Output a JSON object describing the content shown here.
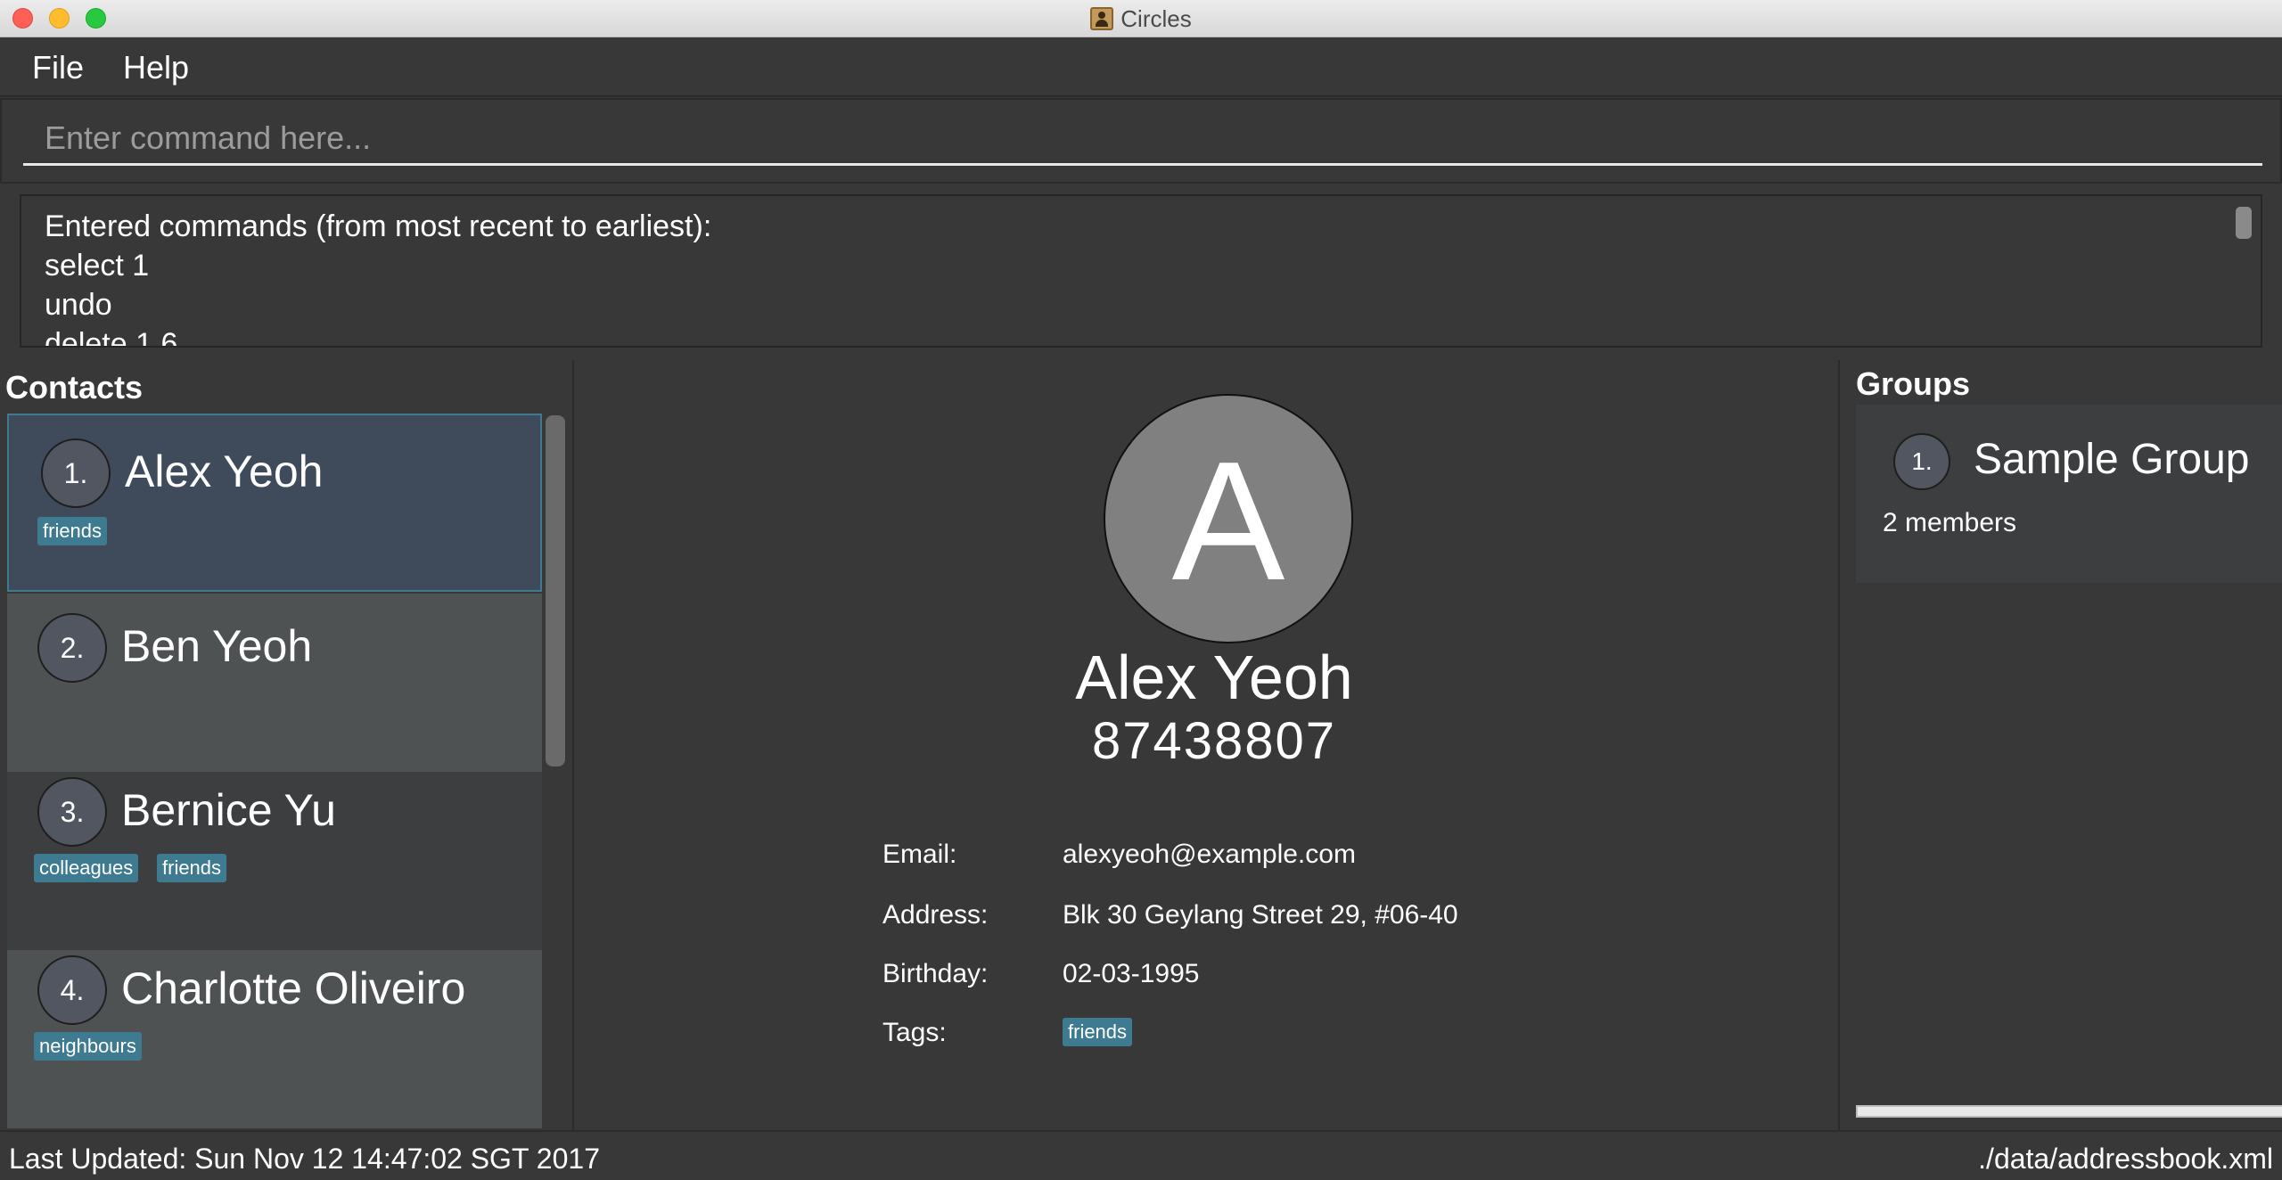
{
  "window": {
    "title": "Circles",
    "app_icon": "address-book-icon"
  },
  "menu": {
    "file": "File",
    "help": "Help"
  },
  "command": {
    "placeholder": "Enter command here...",
    "value": ""
  },
  "result": {
    "text": "Entered commands (from most recent to earliest):\nselect 1\nundo\ndelete 1 6"
  },
  "contacts": {
    "title": "Contacts",
    "items": [
      {
        "index": "1.",
        "name": "Alex Yeoh",
        "tags": [
          "friends"
        ],
        "selected": true
      },
      {
        "index": "2.",
        "name": "Ben Yeoh",
        "tags": []
      },
      {
        "index": "3.",
        "name": "Bernice Yu",
        "tags": [
          "colleagues",
          "friends"
        ]
      },
      {
        "index": "4.",
        "name": "Charlotte Oliveiro",
        "tags": [
          "neighbours"
        ]
      }
    ]
  },
  "detail": {
    "avatar_letter": "A",
    "name": "Alex Yeoh",
    "phone": "87438807",
    "email_label": "Email:",
    "email": "alexyeoh@example.com",
    "address_label": "Address:",
    "address": "Blk 30 Geylang Street 29, #06-40",
    "birthday_label": "Birthday:",
    "birthday": "02-03-1995",
    "tags_label": "Tags:",
    "tags": [
      "friends"
    ]
  },
  "groups": {
    "title": "Groups",
    "items": [
      {
        "index": "1.",
        "name": "Sample Group",
        "members": "2 members"
      }
    ]
  },
  "status": {
    "last_updated": "Last Updated: Sun Nov 12 14:47:02 SGT 2017",
    "file_path": "./data/addressbook.xml"
  },
  "colors": {
    "background": "#383838",
    "tag": "#3e7b91",
    "selected_card": "#3f4a5b",
    "avatar": "#808080"
  }
}
